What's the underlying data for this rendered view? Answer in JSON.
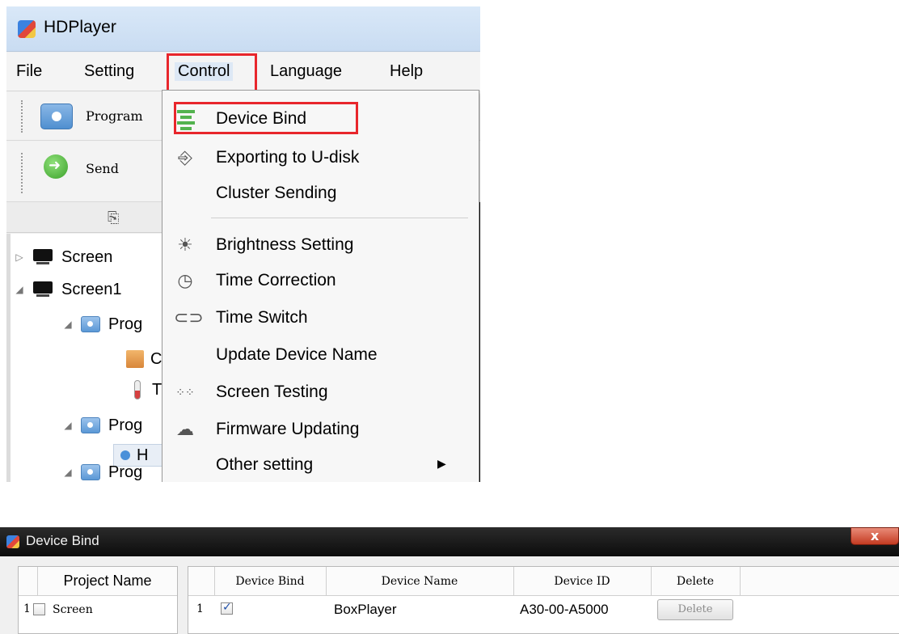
{
  "app": {
    "title": "HDPlayer"
  },
  "menubar": {
    "items": [
      "File",
      "Setting",
      "Control",
      "Language",
      "Help"
    ]
  },
  "toolbar": {
    "program_label": "Program",
    "send_label": "Send"
  },
  "tree": {
    "items": [
      "Screen",
      "Screen1",
      "Prog",
      "C",
      "T",
      "Prog",
      "H",
      "Prog"
    ]
  },
  "control_menu": {
    "items": [
      {
        "label": "Device Bind",
        "icon": "device-bind-icon"
      },
      {
        "label": "Exporting to U-disk",
        "icon": "usb-icon"
      },
      {
        "label": "Cluster Sending",
        "icon": ""
      },
      {
        "label": "Brightness Setting",
        "icon": "bulb-icon"
      },
      {
        "label": "Time Correction",
        "icon": "clock-icon"
      },
      {
        "label": "Time Switch",
        "icon": "toggle-icon"
      },
      {
        "label": "Update Device Name",
        "icon": ""
      },
      {
        "label": "Screen Testing",
        "icon": "dots-grid-icon"
      },
      {
        "label": "Firmware Updating",
        "icon": "cloud-icon"
      },
      {
        "label": "Other setting",
        "icon": ""
      }
    ]
  },
  "highlight_color": "#e8262c",
  "dialog": {
    "title": "Device Bind",
    "close_label": "x",
    "project_table": {
      "header": "Project Name",
      "rows": [
        {
          "index": "1",
          "name": "Screen",
          "checked": false
        }
      ]
    },
    "device_table": {
      "headers": [
        "Device Bind",
        "Device Name",
        "Device ID",
        "Delete"
      ],
      "rows": [
        {
          "index": "1",
          "bound": true,
          "device_name": "BoxPlayer",
          "device_id": "A30-00-A5000",
          "delete_label": "Delete"
        }
      ]
    }
  }
}
